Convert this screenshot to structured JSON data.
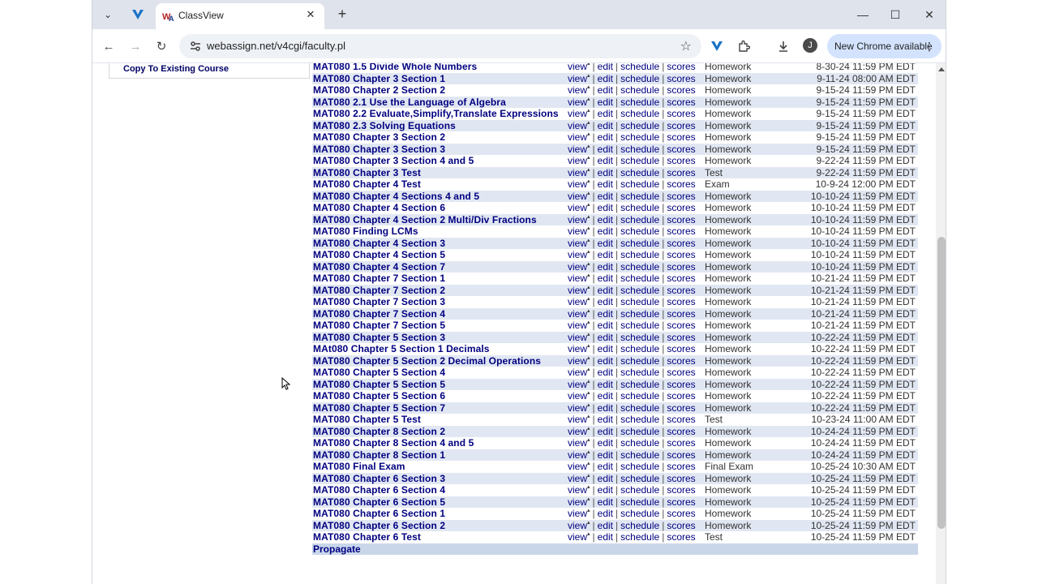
{
  "browser": {
    "tab_title": "ClassView",
    "url": "webassign.net/v4cgi/faculty.pl",
    "update_label": "New Chrome available",
    "avatar_letter": "J"
  },
  "sidebar": {
    "link": "Copy To Existing Course"
  },
  "assignments": [
    {
      "name": "MAT080 1.5 Divide Whole Numbers",
      "type": "Homework",
      "due": "8-30-24 11:59 PM EDT"
    },
    {
      "name": "MAT080 Chapter 3 Section 1",
      "type": "Homework",
      "due": "9-11-24 08:00 AM EDT"
    },
    {
      "name": "MAT080 Chapter 2 Section 2",
      "type": "Homework",
      "due": "9-15-24 11:59 PM EDT"
    },
    {
      "name": "MAT080 2.1 Use the Language of Algebra",
      "type": "Homework",
      "due": "9-15-24 11:59 PM EDT"
    },
    {
      "name": "MAT080 2.2 Evaluate,Simplify,Translate Expressions",
      "type": "Homework",
      "due": "9-15-24 11:59 PM EDT"
    },
    {
      "name": "MAT080 2.3 Solving Equations",
      "type": "Homework",
      "due": "9-15-24 11:59 PM EDT"
    },
    {
      "name": "MAT080 Chapter 3 Section 2",
      "type": "Homework",
      "due": "9-15-24 11:59 PM EDT"
    },
    {
      "name": "MAT080 Chapter 3 Section 3",
      "type": "Homework",
      "due": "9-15-24 11:59 PM EDT"
    },
    {
      "name": "MAT080 Chapter 3 Section 4 and 5",
      "type": "Homework",
      "due": "9-22-24 11:59 PM EDT"
    },
    {
      "name": "MAT080 Chapter 3 Test",
      "type": "Test",
      "due": "9-22-24 11:59 PM EDT"
    },
    {
      "name": "MAT080 Chapter 4 Test",
      "type": "Exam",
      "due": "10-9-24 12:00 PM EDT"
    },
    {
      "name": "MAT080 Chapter 4 Sections 4 and 5",
      "type": "Homework",
      "due": "10-10-24 11:59 PM EDT"
    },
    {
      "name": "MAT080 Chapter 4 Section 6",
      "type": "Homework",
      "due": "10-10-24 11:59 PM EDT"
    },
    {
      "name": "MAT080 Chapter 4 Section 2 Multi/Div Fractions",
      "type": "Homework",
      "due": "10-10-24 11:59 PM EDT"
    },
    {
      "name": "MAT080 Finding LCMs",
      "type": "Homework",
      "due": "10-10-24 11:59 PM EDT"
    },
    {
      "name": "MAT080 Chapter 4 Section 3",
      "type": "Homework",
      "due": "10-10-24 11:59 PM EDT"
    },
    {
      "name": "MAT080 Chapter 4 Section 5",
      "type": "Homework",
      "due": "10-10-24 11:59 PM EDT"
    },
    {
      "name": "MAT080 Chapter 4 Section 7",
      "type": "Homework",
      "due": "10-10-24 11:59 PM EDT"
    },
    {
      "name": "MAT080 Chapter 7 Section 1",
      "type": "Homework",
      "due": "10-21-24 11:59 PM EDT"
    },
    {
      "name": "MAT080 Chapter 7 Section 2",
      "type": "Homework",
      "due": "10-21-24 11:59 PM EDT"
    },
    {
      "name": "MAT080 Chapter 7 Section 3",
      "type": "Homework",
      "due": "10-21-24 11:59 PM EDT"
    },
    {
      "name": "MAT080 Chapter 7 Section 4",
      "type": "Homework",
      "due": "10-21-24 11:59 PM EDT"
    },
    {
      "name": "MAT080 Chapter 7 Section 5",
      "type": "Homework",
      "due": "10-21-24 11:59 PM EDT"
    },
    {
      "name": "MAT080 Chapter 5 Section 3",
      "type": "Homework",
      "due": "10-22-24 11:59 PM EDT"
    },
    {
      "name": "MAt080 Chapter 5 Section 1 Decimals",
      "type": "Homework",
      "due": "10-22-24 11:59 PM EDT"
    },
    {
      "name": "MAT080 Chapter 5 Section 2 Decimal Operations",
      "type": "Homework",
      "due": "10-22-24 11:59 PM EDT"
    },
    {
      "name": "MAT080 Chapter 5 Section 4",
      "type": "Homework",
      "due": "10-22-24 11:59 PM EDT"
    },
    {
      "name": "MAT080 Chapter 5 Section 5",
      "type": "Homework",
      "due": "10-22-24 11:59 PM EDT"
    },
    {
      "name": "MAT080 Chapter 5 Section 6",
      "type": "Homework",
      "due": "10-22-24 11:59 PM EDT"
    },
    {
      "name": "MAT080 Chapter 5 Section 7",
      "type": "Homework",
      "due": "10-22-24 11:59 PM EDT"
    },
    {
      "name": "MAT080 Chapter 5 Test",
      "type": "Test",
      "due": "10-23-24 11:00 AM EDT"
    },
    {
      "name": "MAT080 Chapter 8 Section 2",
      "type": "Homework",
      "due": "10-24-24 11:59 PM EDT"
    },
    {
      "name": "MAT080 Chapter 8 Section 4 and 5",
      "type": "Homework",
      "due": "10-24-24 11:59 PM EDT"
    },
    {
      "name": "MAT080 Chapter 8 Section 1",
      "type": "Homework",
      "due": "10-24-24 11:59 PM EDT"
    },
    {
      "name": "MAT080 Final Exam",
      "type": "Final Exam",
      "due": "10-25-24 10:30 AM EDT"
    },
    {
      "name": "MAT080 Chapter 6 Section 3",
      "type": "Homework",
      "due": "10-25-24 11:59 PM EDT"
    },
    {
      "name": "MAT080 Chapter 6 Section 4",
      "type": "Homework",
      "due": "10-25-24 11:59 PM EDT"
    },
    {
      "name": "MAT080 Chapter 6 Section 5",
      "type": "Homework",
      "due": "10-25-24 11:59 PM EDT"
    },
    {
      "name": "MAT080 Chapter 6 Section 1",
      "type": "Homework",
      "due": "10-25-24 11:59 PM EDT"
    },
    {
      "name": "MAT080 Chapter 6 Section 2",
      "type": "Homework",
      "due": "10-25-24 11:59 PM EDT"
    },
    {
      "name": "MAT080 Chapter 6 Test",
      "type": "Test",
      "due": "10-25-24 11:59 PM EDT"
    }
  ],
  "actions": {
    "view": "view",
    "edit": "edit",
    "schedule": "schedule",
    "scores": "scores",
    "sep": "|"
  },
  "footer": {
    "propagate": "Propagate"
  }
}
